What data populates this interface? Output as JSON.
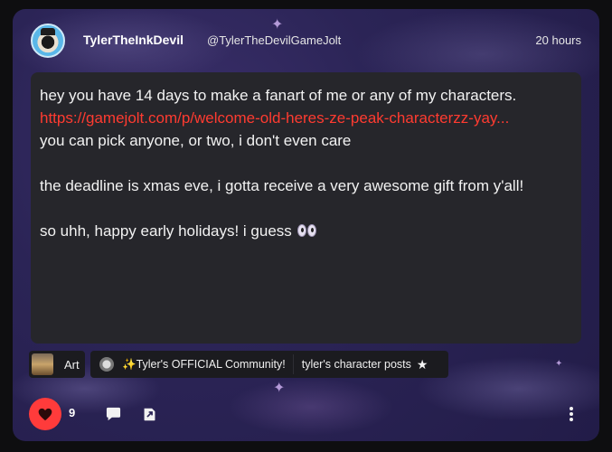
{
  "post": {
    "author_name": "TylerTheInkDevil",
    "author_handle": "@TylerTheDevilGameJolt",
    "timestamp": "20 hours",
    "lines": {
      "l1": "hey you have 14 days to make a fanart of me or any of my characters.",
      "link": "https://gamejolt.com/p/welcome-old-heres-ze-peak-characterzz-yay...",
      "l2": "you can pick anyone, or two, i don't even care",
      "l3": "the deadline is xmas eve, i gotta receive a very awesome gift from y'all!",
      "l4": "so uhh, happy early holidays! i guess"
    }
  },
  "tags": {
    "category": "Art",
    "community": "✨Tyler's OFFICIAL Community!",
    "channel": "tyler's character posts"
  },
  "actions": {
    "like_count": "9"
  },
  "colors": {
    "like_red": "#ff3b3b",
    "link_red": "#ff3b30",
    "content_bg": "#26262b"
  }
}
